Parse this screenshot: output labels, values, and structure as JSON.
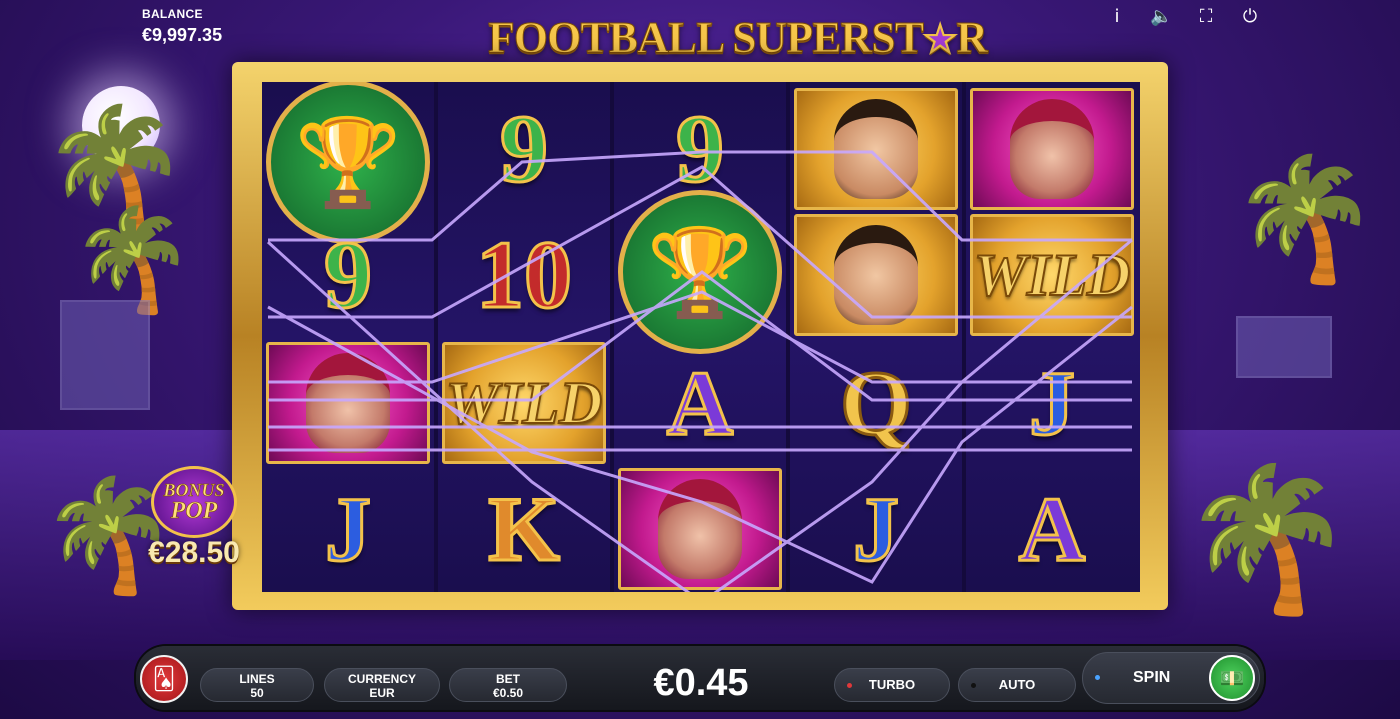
{
  "header": {
    "balance_label": "BALANCE",
    "balance_value": "€9,997.35",
    "title_main": "FOOTBALL SUPERST",
    "title_end": "R"
  },
  "top_icons": [
    "info-icon",
    "sound-icon",
    "fullscreen-icon",
    "power-icon"
  ],
  "reels": [
    [
      "trophy",
      "9",
      "woman",
      "J"
    ],
    [
      "9",
      "10",
      "WILD",
      "K"
    ],
    [
      "9",
      "trophy",
      "A",
      "woman"
    ],
    [
      "man",
      "man",
      "Q",
      "J"
    ],
    [
      "woman",
      "WILD",
      "J",
      "A"
    ]
  ],
  "symbols": {
    "wild_text": "WILD",
    "nine": "9",
    "ten": "10",
    "a": "A",
    "k": "K",
    "q": "Q",
    "j": "J"
  },
  "bonus": {
    "line1": "BONUS",
    "line2": "POP",
    "amount": "€28.50"
  },
  "controls": {
    "lines_label": "LINES",
    "lines_value": "50",
    "currency_label": "CURRENCY",
    "currency_value": "EUR",
    "bet_label": "BET",
    "bet_value": "€0.50",
    "win_value": "€0.45",
    "turbo_label": "TURBO",
    "auto_label": "AUTO",
    "spin_label": "SPIN"
  },
  "colors": {
    "accent_gold": "#f3c24a",
    "background": "#3a1878",
    "turbo_dot": "#e0383a",
    "auto_dot": "#222222",
    "spin_dot": "#4aa3ff",
    "spin_button": "#2fb24b"
  }
}
